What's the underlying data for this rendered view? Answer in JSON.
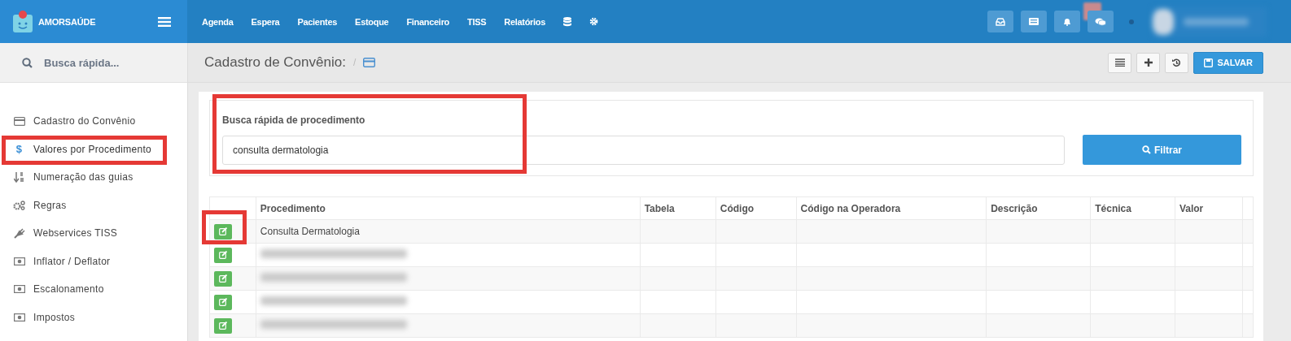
{
  "brand": {
    "name": "AMORSAÚDE"
  },
  "nav": [
    "Agenda",
    "Espera",
    "Pacientes",
    "Estoque",
    "Financeiro",
    "TISS",
    "Relatórios"
  ],
  "sidebar": {
    "search_placeholder": "Busca rápida...",
    "items": [
      {
        "label": "Cadastro do Convênio",
        "kind": "card",
        "selected": false,
        "highlighted": false
      },
      {
        "label": "Valores por Procedimento",
        "kind": "symbol",
        "symbol": "$",
        "selected": true,
        "highlighted": true
      },
      {
        "label": "Numeração das guias",
        "kind": "sort",
        "selected": false,
        "highlighted": false
      },
      {
        "label": "Regras",
        "kind": "gears",
        "selected": false,
        "highlighted": false
      },
      {
        "label": "Webservices TISS",
        "kind": "plug",
        "selected": false,
        "highlighted": false
      },
      {
        "label": "Inflator / Deflator",
        "kind": "note",
        "selected": false,
        "highlighted": false
      },
      {
        "label": "Escalonamento",
        "kind": "note",
        "selected": false,
        "highlighted": false
      },
      {
        "label": "Impostos",
        "kind": "note",
        "selected": false,
        "highlighted": false
      }
    ]
  },
  "page": {
    "title": "Cadastro de Convênio:",
    "separator": "/",
    "save_button": "SALVAR"
  },
  "search_panel": {
    "label": "Busca rápida de procedimento",
    "value": "consulta dermatologia",
    "button": "Filtrar",
    "highlighted": true
  },
  "table": {
    "columns": [
      "Procedimento",
      "Tabela",
      "Código",
      "Código na Operadora",
      "Descrição",
      "Técnica",
      "Valor"
    ],
    "rows": [
      {
        "procedure": "Consulta Dermatologia",
        "blurred": false,
        "highlighted": true
      },
      {
        "blurred": true,
        "highlighted": false
      },
      {
        "blurred": true,
        "highlighted": false
      },
      {
        "blurred": true,
        "highlighted": false
      },
      {
        "blurred": true,
        "highlighted": false
      }
    ]
  }
}
